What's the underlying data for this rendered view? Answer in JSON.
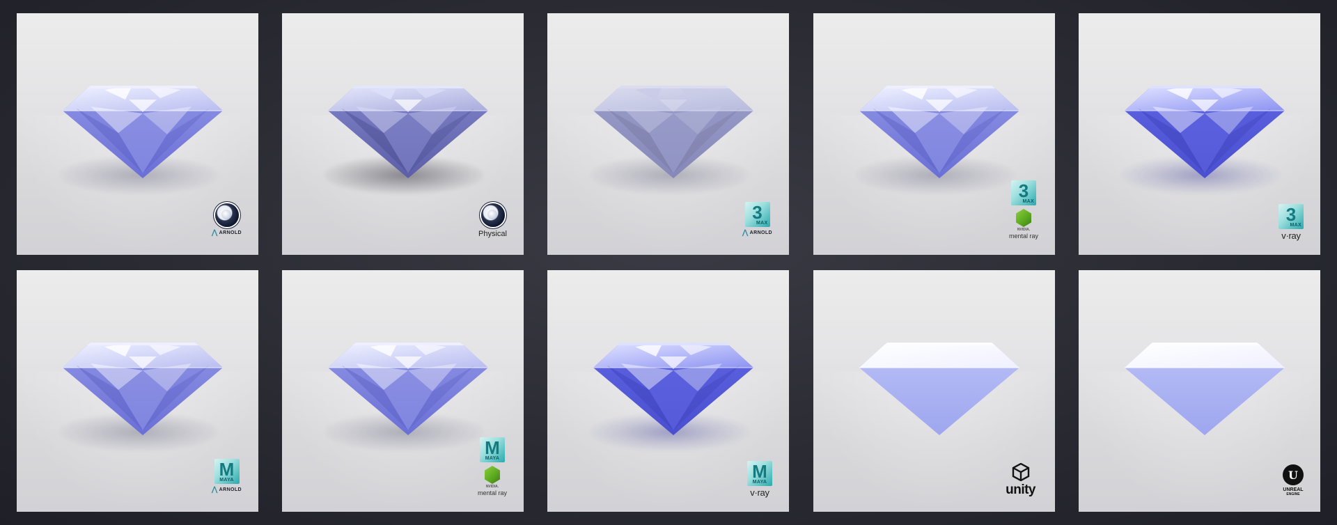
{
  "tiles": [
    {
      "row": 0,
      "col": 0,
      "variant": "sparkle",
      "shadow": "soft",
      "badge": "c4d-arnold",
      "labels": {
        "arnold": "ARNOLD"
      }
    },
    {
      "row": 0,
      "col": 1,
      "variant": "dark",
      "shadow": "dark",
      "badge": "c4d-physical",
      "labels": {
        "physical": "Physical"
      }
    },
    {
      "row": 0,
      "col": 2,
      "variant": "matte",
      "shadow": "soft",
      "badge": "max-arnold",
      "labels": {
        "max": "MAX",
        "arnold": "ARNOLD"
      }
    },
    {
      "row": 0,
      "col": 3,
      "variant": "sparkle",
      "shadow": "soft",
      "badge": "max-mentalray",
      "labels": {
        "max": "MAX",
        "nvidia": "NVIDIA.",
        "mental": "mental ray"
      }
    },
    {
      "row": 0,
      "col": 4,
      "variant": "blue",
      "shadow": "blue",
      "badge": "max-vray",
      "labels": {
        "max": "MAX",
        "vray": "v·ray"
      }
    },
    {
      "row": 1,
      "col": 0,
      "variant": "sparkle",
      "shadow": "soft",
      "badge": "maya-arnold",
      "labels": {
        "maya": "MAYA",
        "arnold": "ARNOLD"
      }
    },
    {
      "row": 1,
      "col": 1,
      "variant": "sparkle",
      "shadow": "soft",
      "badge": "maya-mentalray",
      "labels": {
        "maya": "MAYA",
        "nvidia": "NVIDIA.",
        "mental": "mental ray"
      }
    },
    {
      "row": 1,
      "col": 2,
      "variant": "blue",
      "shadow": "blue",
      "badge": "maya-vray",
      "labels": {
        "maya": "MAYA",
        "vray": "v·ray"
      }
    },
    {
      "row": 1,
      "col": 3,
      "variant": "flat",
      "shadow": "none",
      "badge": "unity",
      "labels": {
        "unity": "unity"
      }
    },
    {
      "row": 1,
      "col": 4,
      "variant": "flat",
      "shadow": "none",
      "badge": "unreal",
      "labels": {
        "unreal": "UNREAL",
        "engine": "ENGINE"
      }
    }
  ],
  "icons": {
    "cinema4d": "cinema4d-logo-icon",
    "max": "3dsmax-logo-icon",
    "maya": "maya-logo-icon",
    "arnold": "arnold-logo-icon",
    "mentalray": "mental-ray-logo-icon",
    "vray": "vray-logo-icon",
    "unity": "unity-logo-icon",
    "unreal": "unreal-engine-logo-icon"
  },
  "colors": {
    "frame_bg": "#2a2b33",
    "tile_bg": "#e4e4e6",
    "gem_blue": "#7a7fe0",
    "gem_light": "#c9cdf5",
    "teal": "#2aa9ad"
  }
}
